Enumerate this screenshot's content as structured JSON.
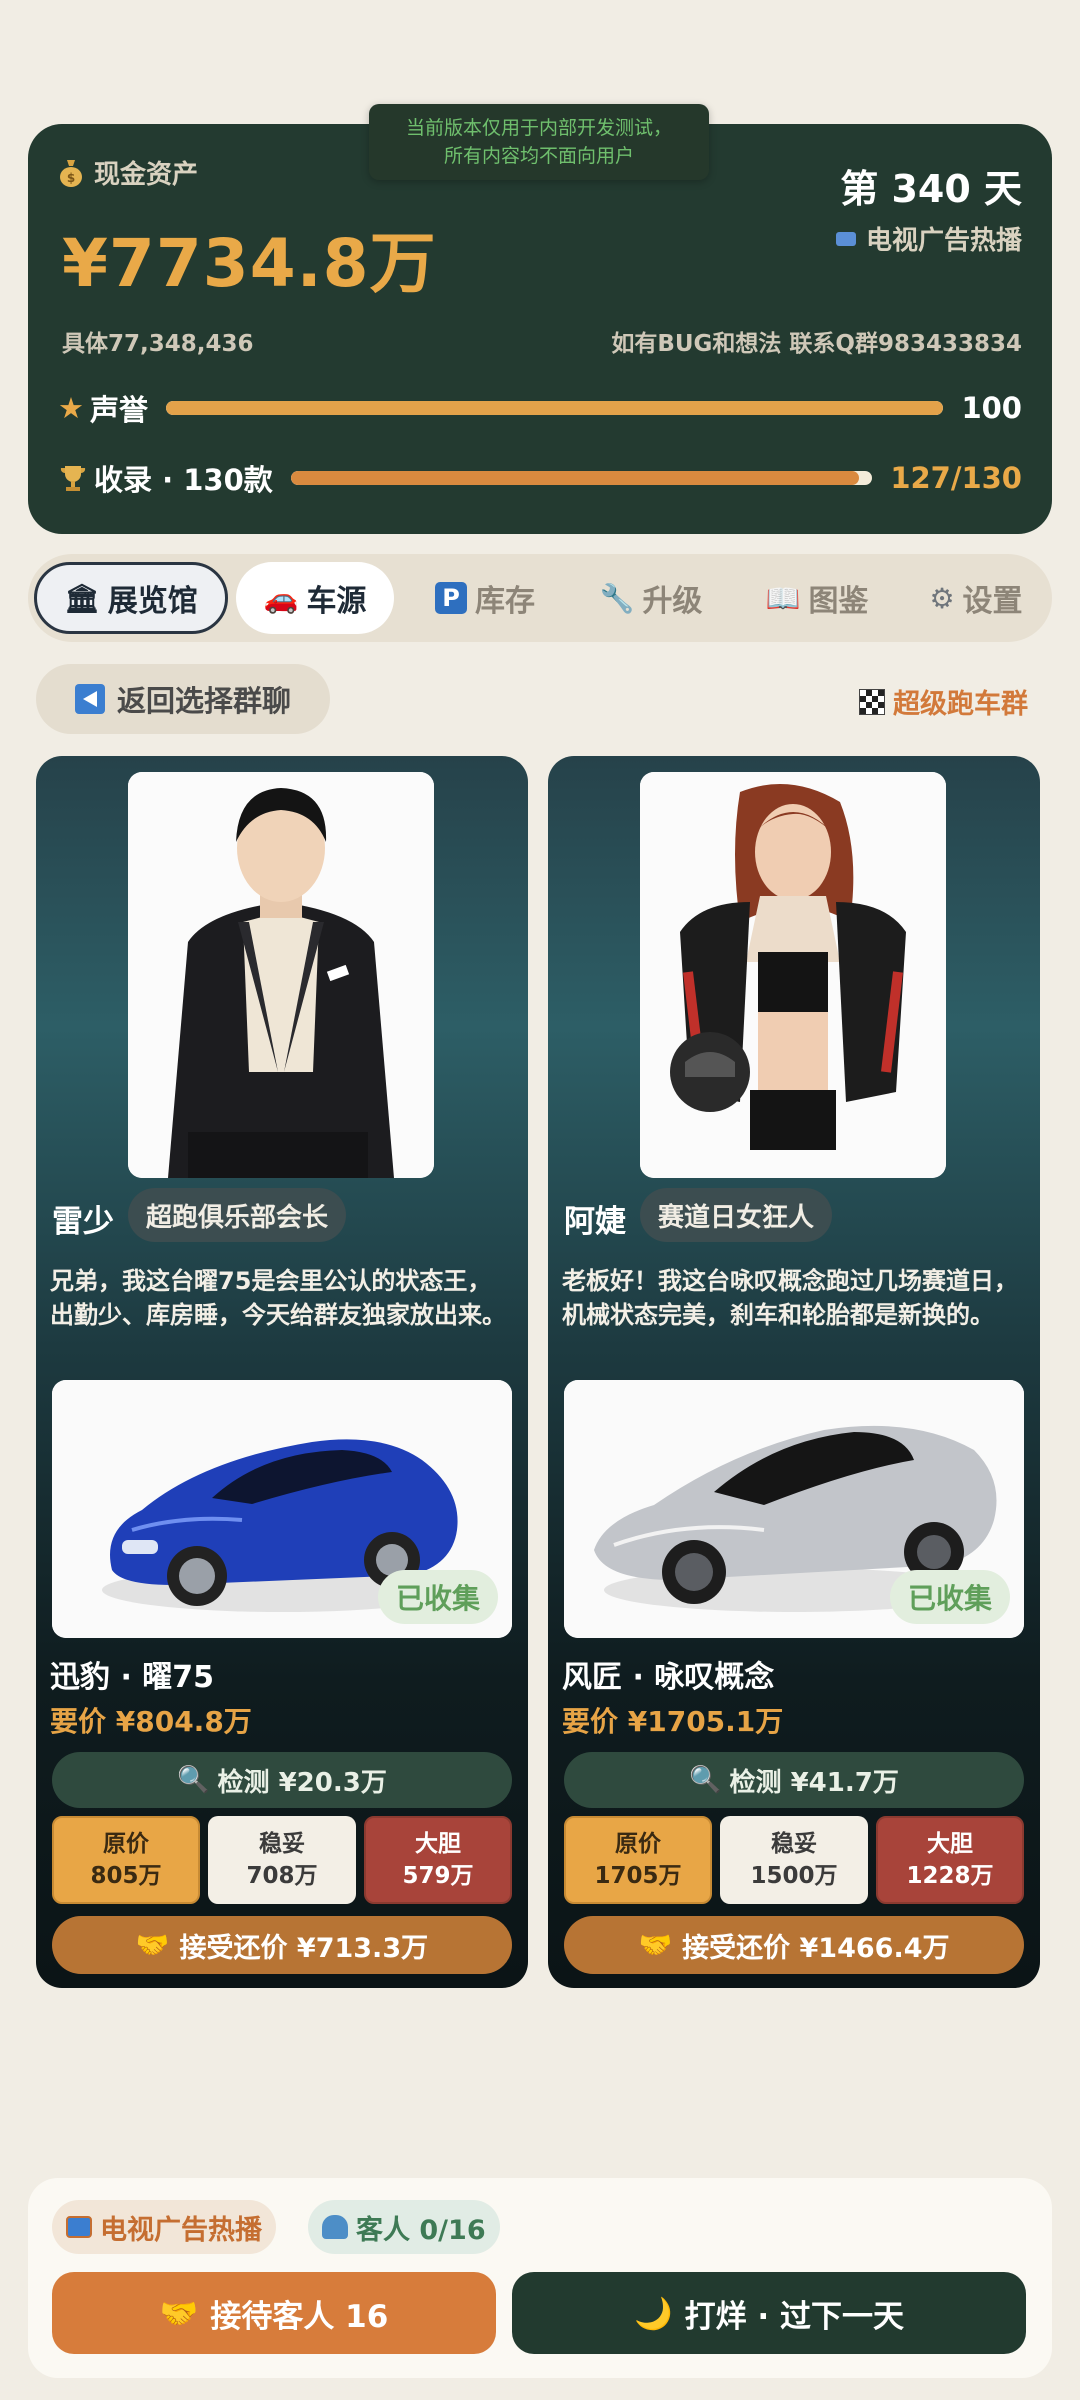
{
  "dev_notice": {
    "line1": "当前版本仅用于内部开发测试，",
    "line2": "所有内容均不面向用户"
  },
  "status": {
    "cash_label": "现金资产",
    "cash_value": "¥7734.8万",
    "day": "第 340 天",
    "ad_status": "电视广告热播",
    "exact_amount": "具体77,348,436",
    "contact": "如有BUG和想法 联系Q群983433834",
    "reputation": {
      "label": "声誉",
      "value": "100",
      "fraction": 1.0
    },
    "collection": {
      "label": "收录 · 130款",
      "value": "127/130",
      "fraction": 0.977
    }
  },
  "tabs": [
    {
      "label": "展览馆",
      "icon": "🏛"
    },
    {
      "label": "车源",
      "icon": "🚗"
    },
    {
      "label": "库存",
      "icon": "P"
    },
    {
      "label": "升级",
      "icon": "🔧"
    },
    {
      "label": "图鉴",
      "icon": "📖"
    },
    {
      "label": "设置",
      "icon": "⚙"
    }
  ],
  "back_button": "返回选择群聊",
  "group_name": "超级跑车群",
  "sellers": [
    {
      "name": "雷少",
      "tag": "超跑俱乐部会长",
      "quote": "兄弟，我这台曜75是会里公认的状态王，出勤少、库房睡，今天给群友独家放出来。",
      "collected": "已收集",
      "car_name": "迅豹 · 曜75",
      "asking": "要价 ¥804.8万",
      "inspect": "检测 ¥20.3万",
      "prices": [
        {
          "label": "原价",
          "value": "805万"
        },
        {
          "label": "稳妥",
          "value": "708万"
        },
        {
          "label": "大胆",
          "value": "579万"
        }
      ],
      "accept": "接受还价 ¥713.3万",
      "car_color": "#1f3fb8"
    },
    {
      "name": "阿婕",
      "tag": "赛道日女狂人",
      "quote": "老板好！我这台咏叹概念跑过几场赛道日，机械状态完美，刹车和轮胎都是新换的。",
      "collected": "已收集",
      "car_name": "风匠 · 咏叹概念",
      "asking": "要价 ¥1705.1万",
      "inspect": "检测 ¥41.7万",
      "prices": [
        {
          "label": "原价",
          "value": "1705万"
        },
        {
          "label": "稳妥",
          "value": "1500万"
        },
        {
          "label": "大胆",
          "value": "1228万"
        }
      ],
      "accept": "接受还价 ¥1466.4万",
      "car_color": "#b9bcc1"
    }
  ],
  "bottom": {
    "chip_tv": "电视广告热播",
    "chip_guests": "客人 0/16",
    "receive_button": "接待客人 16",
    "close_button": "打烊 · 过下一天"
  },
  "colors": {
    "accent_orange": "#e9a948",
    "dark_green": "#233a30",
    "reputation_bar": "#e3a24a",
    "collection_bar": "#d98a3f"
  }
}
